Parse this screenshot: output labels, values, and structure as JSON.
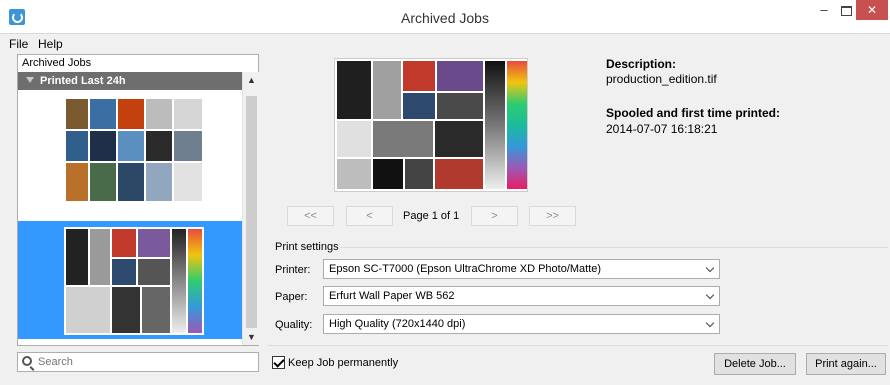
{
  "window": {
    "title": "Archived Jobs",
    "minimize": "–",
    "close": "✕"
  },
  "menu": {
    "file": "File",
    "help": "Help"
  },
  "tree": {
    "root": "Archived Jobs",
    "group": "Printed Last 24h"
  },
  "search": {
    "placeholder": "Search"
  },
  "pager": {
    "first": "<<",
    "prev": "<",
    "page": "Page 1 of 1",
    "next": ">",
    "last": ">>"
  },
  "details": {
    "description_label": "Description:",
    "description_value": "production_edition.tif",
    "spooled_label": "Spooled and first time printed:",
    "spooled_value": "2014-07-07 16:18:21"
  },
  "print_settings": {
    "title": "Print settings",
    "printer_label": "Printer:",
    "printer_value": "Epson SC-T7000 (Epson UltraChrome XD Photo/Matte)",
    "paper_label": "Paper:",
    "paper_value": "Erfurt Wall Paper WB 562",
    "quality_label": "Quality:",
    "quality_value": "High Quality (720x1440 dpi)"
  },
  "keep_job": {
    "label": "Keep Job permanently",
    "checked": true
  },
  "buttons": {
    "delete": "Delete Job...",
    "print_again": "Print again..."
  },
  "colors": {
    "selection": "#3399ff",
    "group_header": "#6e6e6e",
    "close": "#c75050"
  }
}
